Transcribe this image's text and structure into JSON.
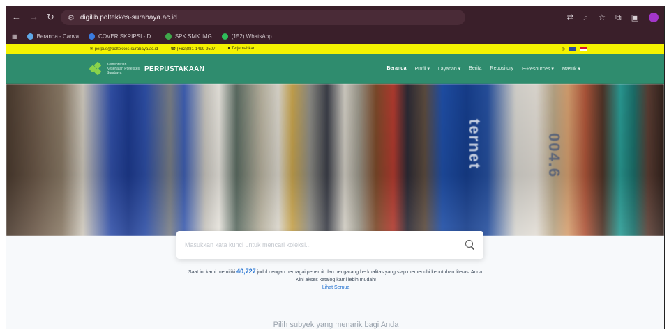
{
  "browser": {
    "url": "digilib.poltekkes-surabaya.ac.id",
    "bookmarks": [
      {
        "label": "Beranda - Canva",
        "color": "#5fa8e8"
      },
      {
        "label": "COVER SKRIPSI - D...",
        "color": "#3b7be0"
      },
      {
        "label": "SPK SMK IMG",
        "color": "#3fa84b"
      },
      {
        "label": "(152) WhatsApp",
        "color": "#2ebd5a"
      }
    ]
  },
  "topbar": {
    "email": "perpus@poltekkes-surabaya.ac.id",
    "phone": "(+62)881-1499-9507",
    "language": "Terjemahkan"
  },
  "navbar": {
    "brand_sub": "Kementerian Kesehatan Poltekkes Surabaya",
    "brand_title": "PERPUSTAKAAN",
    "menu": [
      "Beranda",
      "Profil ▾",
      "Layanan ▾",
      "Berita",
      "Repository",
      "E-Resources ▾",
      "Masuk ▾"
    ]
  },
  "hero": {
    "spine_1": "ternet",
    "spine_2": "004.6"
  },
  "search": {
    "placeholder": "Masukkan kata kunci untuk mencari koleksi..."
  },
  "info": {
    "line1_prefix": "Saat ini kami memiliki",
    "count": "40,727",
    "line1_suffix": "judul dengan berbagai penerbit dan pengarang berkualitas yang siap memenuhi kebutuhan literasi Anda.",
    "line2": "Kini akses katalog kami lebih mudah!",
    "link": "Lihat Semua"
  },
  "subtitle": "Pilih subyek yang menarik bagi Anda"
}
